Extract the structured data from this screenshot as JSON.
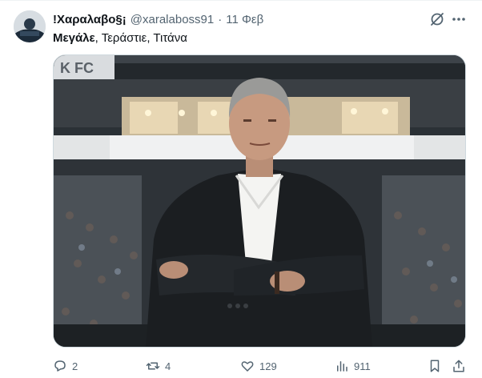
{
  "tweet": {
    "display_name": "!Χαραλαβο§¡",
    "handle": "@xaralaboss91",
    "separator": "·",
    "date": "11 Φεβ",
    "text_bold": "Μεγάλε",
    "text_rest": ", Τεράστιε, Τιτάνα",
    "media_sign_text": "K FC"
  },
  "actions": {
    "replies": "2",
    "reposts": "4",
    "likes": "129",
    "views": "911"
  },
  "icons": {
    "grok": "grok-icon",
    "more": "more-dots-icon",
    "reply": "reply-icon",
    "repost": "repost-icon",
    "like": "heart-icon",
    "views": "views-bars-icon",
    "bookmark": "bookmark-icon",
    "share": "share-icon"
  },
  "colors": {
    "text_primary": "#0f1419",
    "text_secondary": "#536471",
    "border": "#cfd9de"
  }
}
